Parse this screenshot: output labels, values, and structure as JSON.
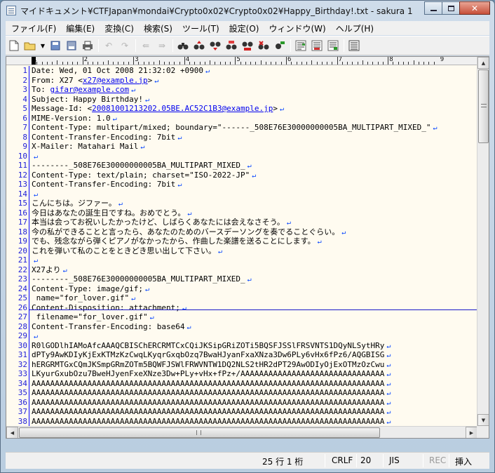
{
  "window": {
    "title": "マイドキュメント¥CTFJapan¥mondai¥Crypto0x02¥Crypto0x02¥Happy_Birthday!.txt - sakura 1..."
  },
  "menu": [
    {
      "label": "ファイル(F)"
    },
    {
      "label": "編集(E)"
    },
    {
      "label": "変換(C)"
    },
    {
      "label": "検索(S)"
    },
    {
      "label": "ツール(T)"
    },
    {
      "label": "設定(O)"
    },
    {
      "label": "ウィンドウ(W)"
    },
    {
      "label": "ヘルプ(H)"
    }
  ],
  "ruler": {
    "labels": [
      "1",
      "2",
      "3",
      "4",
      "5",
      "6",
      "7",
      "8",
      "9"
    ]
  },
  "lines": [
    {
      "n": "1",
      "text": "Date: Wed, 01 Oct 2008 21:32:02 +0900"
    },
    {
      "n": "2",
      "text": "From: X27 <",
      "link": "x27@example.jp",
      "after": ">"
    },
    {
      "n": "3",
      "text": "To: ",
      "link": "gifar@example.com",
      "after": ""
    },
    {
      "n": "4",
      "text": "Subject: Happy Birthday!"
    },
    {
      "n": "5",
      "text": "Message-Id: <",
      "link": "20081001213202.05BE.AC52C1B3@example.jp",
      "after": ">"
    },
    {
      "n": "6",
      "text": "MIME-Version: 1.0"
    },
    {
      "n": "7",
      "text": "Content-Type: multipart/mixed; boundary=\"------_508E76E30000000005BA_MULTIPART_MIXED_\""
    },
    {
      "n": "8",
      "text": "Content-Transfer-Encoding: 7bit"
    },
    {
      "n": "9",
      "text": "X-Mailer: Matahari Mail"
    },
    {
      "n": "10",
      "text": ""
    },
    {
      "n": "11",
      "text": "--------_508E76E30000000005BA_MULTIPART_MIXED_"
    },
    {
      "n": "12",
      "text": "Content-Type: text/plain; charset=\"ISO-2022-JP\""
    },
    {
      "n": "13",
      "text": "Content-Transfer-Encoding: 7bit"
    },
    {
      "n": "14",
      "text": ""
    },
    {
      "n": "15",
      "text": "こんにちは。ジファー。"
    },
    {
      "n": "16",
      "text": "今日はあなたの誕生日ですね。おめでとう。"
    },
    {
      "n": "17",
      "text": "本当は会ってお祝いしたかったけど、しばらくあなたには会えなさそう。"
    },
    {
      "n": "18",
      "text": "今の私ができることと言ったら、あなたのためのバースデーソングを奏でることぐらい。"
    },
    {
      "n": "19",
      "text": "でも、残念ながら弾くピアノがなかったから、作曲した楽譜を送ることにします。"
    },
    {
      "n": "20",
      "text": "これを弾いて私のことをときどき思い出して下さい。"
    },
    {
      "n": "21",
      "text": ""
    },
    {
      "n": "22",
      "text": "X27より"
    },
    {
      "n": "23",
      "text": "--------_508E76E30000000005BA_MULTIPART_MIXED_"
    },
    {
      "n": "24",
      "text": "Content-Type: image/gif;"
    },
    {
      "n": "25",
      "text": " name=\"for_lover.gif\""
    },
    {
      "n": "26",
      "text": "Content-Disposition: attachment;"
    },
    {
      "n": "27",
      "text": " filename=\"for_lover.gif\""
    },
    {
      "n": "28",
      "text": "Content-Transfer-Encoding: base64"
    },
    {
      "n": "29",
      "text": ""
    },
    {
      "n": "30",
      "text": "R0lGODlhIAMoAfcAAAQCBISChERCRMTCxCQiJKSipGRiZOTi5BQSFJSSlFRSVNTS1DQyNLSytHRy"
    },
    {
      "n": "31",
      "text": "dPTy9AwKDIyKjExKTMzKzCwqLKyqrGxqbOzq7BwaHJyanFxaXNza3Dw6PLy6vHx6fPz6/AQGBISG"
    },
    {
      "n": "32",
      "text": "hERGRMTGxCQmJKSmpGRmZOTm5BQWFJSWlFRWVNTW1DQ2NLS2tHR2dPT29AwODIyOjExOTMzOzCwu"
    },
    {
      "n": "33",
      "text": "LKyurGxubOzu7BweHJyenFxeXNze3Dw+PLy+vHx+fPz+/AAAAAAAAAAAAAAAAAAAAAAAAAAAAAAA"
    },
    {
      "n": "34",
      "text": "AAAAAAAAAAAAAAAAAAAAAAAAAAAAAAAAAAAAAAAAAAAAAAAAAAAAAAAAAAAAAAAAAAAAAAAAAAAA"
    },
    {
      "n": "35",
      "text": "AAAAAAAAAAAAAAAAAAAAAAAAAAAAAAAAAAAAAAAAAAAAAAAAAAAAAAAAAAAAAAAAAAAAAAAAAAAA"
    },
    {
      "n": "36",
      "text": "AAAAAAAAAAAAAAAAAAAAAAAAAAAAAAAAAAAAAAAAAAAAAAAAAAAAAAAAAAAAAAAAAAAAAAAAAAAA"
    },
    {
      "n": "37",
      "text": "AAAAAAAAAAAAAAAAAAAAAAAAAAAAAAAAAAAAAAAAAAAAAAAAAAAAAAAAAAAAAAAAAAAAAAAAAAAA"
    },
    {
      "n": "38",
      "text": "AAAAAAAAAAAAAAAAAAAAAAAAAAAAAAAAAAAAAAAAAAAAAAAAAAAAAAAAAAAAAAAAAAAAAAAAAAAA"
    }
  ],
  "status": {
    "position": "25 行    1 桁",
    "line_ending": "CRLF",
    "code": "20",
    "encoding": "JIS",
    "rec": "REC",
    "mode": "挿入"
  },
  "icons": {
    "eol": "↵"
  }
}
